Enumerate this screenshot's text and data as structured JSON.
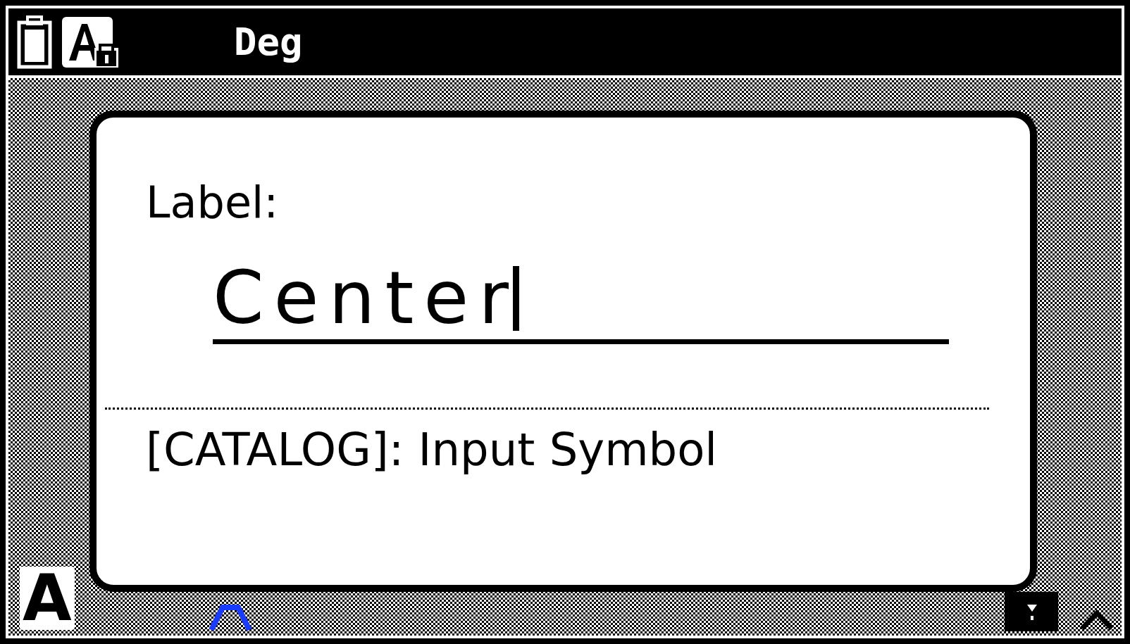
{
  "status_bar": {
    "angle_unit": "Deg"
  },
  "dialog": {
    "label": "Label:",
    "field": {
      "value": "Center"
    },
    "hint": "[CATALOG]: Input Symbol"
  },
  "background": {
    "mode_letter": "A"
  }
}
